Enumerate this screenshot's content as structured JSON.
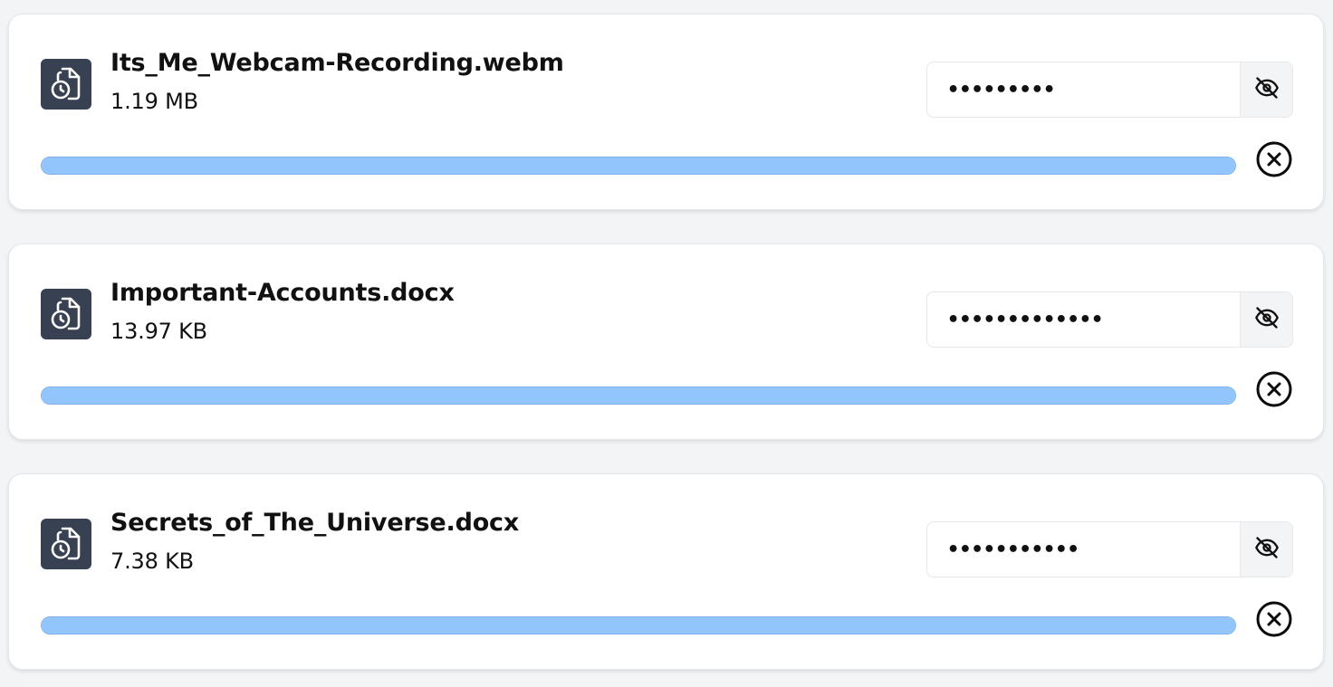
{
  "colors": {
    "background": "#f3f4f6",
    "card": "#ffffff",
    "icon_bg": "#374151",
    "progress_fill": "#93c5fd",
    "text": "#111111"
  },
  "files": [
    {
      "name": "Its_Me_Webcam-Recording.webm",
      "size": "1.19 MB",
      "password_mask": "•••••••••",
      "progress": 1.0,
      "icon": "file-clock-icon",
      "toggle_icon": "eye-off-icon",
      "cancel_icon": "close-circle-icon"
    },
    {
      "name": "Important-Accounts.docx",
      "size": "13.97 KB",
      "password_mask": "•••••••••••••",
      "progress": 1.0,
      "icon": "file-clock-icon",
      "toggle_icon": "eye-off-icon",
      "cancel_icon": "close-circle-icon"
    },
    {
      "name": "Secrets_of_The_Universe.docx",
      "size": "7.38 KB",
      "password_mask": "•••••••••••",
      "progress": 1.0,
      "icon": "file-clock-icon",
      "toggle_icon": "eye-off-icon",
      "cancel_icon": "close-circle-icon"
    }
  ]
}
